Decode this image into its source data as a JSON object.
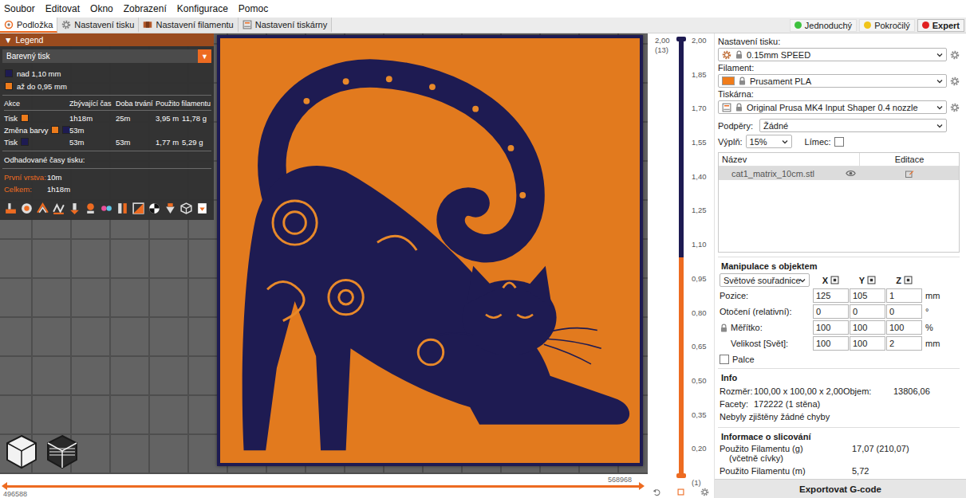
{
  "menu": [
    "Soubor",
    "Editovat",
    "Okno",
    "Zobrazení",
    "Konfigurace",
    "Pomoc"
  ],
  "tabs": [
    {
      "label": "Podložka",
      "selected": true,
      "kind": "plater"
    },
    {
      "label": "Nastavení tisku",
      "selected": false,
      "kind": "print"
    },
    {
      "label": "Nastavení filamentu",
      "selected": false,
      "kind": "filament"
    },
    {
      "label": "Nastavení tiskárny",
      "selected": false,
      "kind": "printer"
    }
  ],
  "modes": [
    {
      "label": "Jednoduchý",
      "selected": false,
      "color": "#3ec13e"
    },
    {
      "label": "Pokročilý",
      "selected": false,
      "color": "#f0c419"
    },
    {
      "label": "Expert",
      "selected": true,
      "color": "#e02020"
    }
  ],
  "legend": {
    "toggle": "▼",
    "title": "Legend",
    "view_type": "Barevný tisk",
    "select_arrow": "▼",
    "ranges": [
      {
        "label": "nad 1,10 mm",
        "color": "#1e1b52"
      },
      {
        "label": "až do 0,95 mm",
        "color": "#ed7b1b"
      }
    ],
    "columns": [
      "Akce",
      "Zbývající čas",
      "Doba trvání",
      "Použito filamentu"
    ],
    "rows": [
      {
        "action": "Tisk",
        "colors": [
          "#ed7b1b"
        ],
        "remaining": "1h18m",
        "duration": "25m",
        "length": "3,95 m",
        "weight": "11,78 g"
      },
      {
        "action": "Změna barvy",
        "colors": [
          "#ed7b1b",
          "#1e1b52"
        ],
        "remaining": "53m"
      },
      {
        "action": "Tisk",
        "colors": [
          "#1e1b52"
        ],
        "remaining": "53m",
        "duration": "53m",
        "length": "1,77 m",
        "weight": "5,29 g"
      }
    ],
    "estimates_title": "Odhadované časy tisku:",
    "estimates": [
      {
        "label": "První vrstva:",
        "value": "10m"
      },
      {
        "label": "Celkem:",
        "value": "1h18m"
      }
    ]
  },
  "layer_slider": {
    "upper_value": "2,00",
    "upper_layer": "(13)",
    "ticks": [
      "2,00",
      "1,85",
      "1,70",
      "1,55",
      "1,40",
      "1,25",
      "1,10",
      "0,95",
      "0,80",
      "0,65",
      "0,50",
      "0,35",
      "0,20"
    ],
    "lower_layer": "(1)",
    "segments": [
      {
        "color": "#1e1b52",
        "level": 0.5
      },
      {
        "color": "#ed6b21",
        "level": 0.5
      }
    ]
  },
  "move_slider": {
    "start": "496588",
    "end": "568968",
    "level": 1
  },
  "presets": [
    {
      "label": "Nastavení tisku:",
      "value": "0.15mm SPEED",
      "kind": "print"
    },
    {
      "label": "Filament:",
      "value": "Prusament PLA",
      "kind": "filament",
      "color": "#f07c1a"
    },
    {
      "label": "Tiskárna:",
      "value": "Original Prusa MK4 Input Shaper 0.4 nozzle",
      "kind": "printer"
    }
  ],
  "supports": {
    "label": "Podpěry:",
    "value": "Žádné"
  },
  "infill": {
    "label": "Výplň:",
    "value": "15%"
  },
  "brim": {
    "label": "Límec:",
    "checked": false
  },
  "object_list": {
    "columns": [
      "Název",
      "Editace"
    ],
    "rows": [
      {
        "name": "cat1_matrix_10cm.stl",
        "selected": true,
        "visible": true
      }
    ]
  },
  "manipulation": {
    "title": "Manipulace s objektem",
    "coordinates": "Světové souřadnice",
    "axes": [
      "X",
      "Y",
      "Z"
    ],
    "scale_locked": true,
    "rows": [
      {
        "label": "Pozice:",
        "values": [
          "125",
          "105",
          "1"
        ],
        "unit": "mm",
        "kind": "move"
      },
      {
        "label": "Otočení (relativní):",
        "values": [
          "0",
          "0",
          "0"
        ],
        "unit": "°",
        "kind": "rotate"
      },
      {
        "label": "Měřítko:",
        "values": [
          "100",
          "100",
          "100"
        ],
        "unit": "%",
        "kind": "scale"
      },
      {
        "label": "Velikost [Svět]:",
        "values": [
          "100",
          "100",
          "2"
        ],
        "unit": "mm",
        "kind": "size"
      }
    ],
    "inches": {
      "label": "Palce",
      "checked": false
    }
  },
  "info": {
    "title": "Info",
    "rows": [
      {
        "label": "Rozměr:",
        "value": "100,00 x 100,00 x 2,00",
        "extra_label": "Objem:",
        "extra_value": "13806,06"
      },
      {
        "label": "Facety:",
        "value": "172222 (1 stěna)"
      }
    ],
    "status": "Nebyly zjištěny žádné chyby"
  },
  "slicing": {
    "title": "Informace o slicování",
    "rows": [
      {
        "label": "Použito Filamentu (g)",
        "sublabel": "(včetně cívky)",
        "value": "17,07 (210,07)"
      },
      {
        "label": "Použito Filamentu (m)",
        "value": "5,72"
      }
    ]
  },
  "export_button": "Exportovat G-code"
}
